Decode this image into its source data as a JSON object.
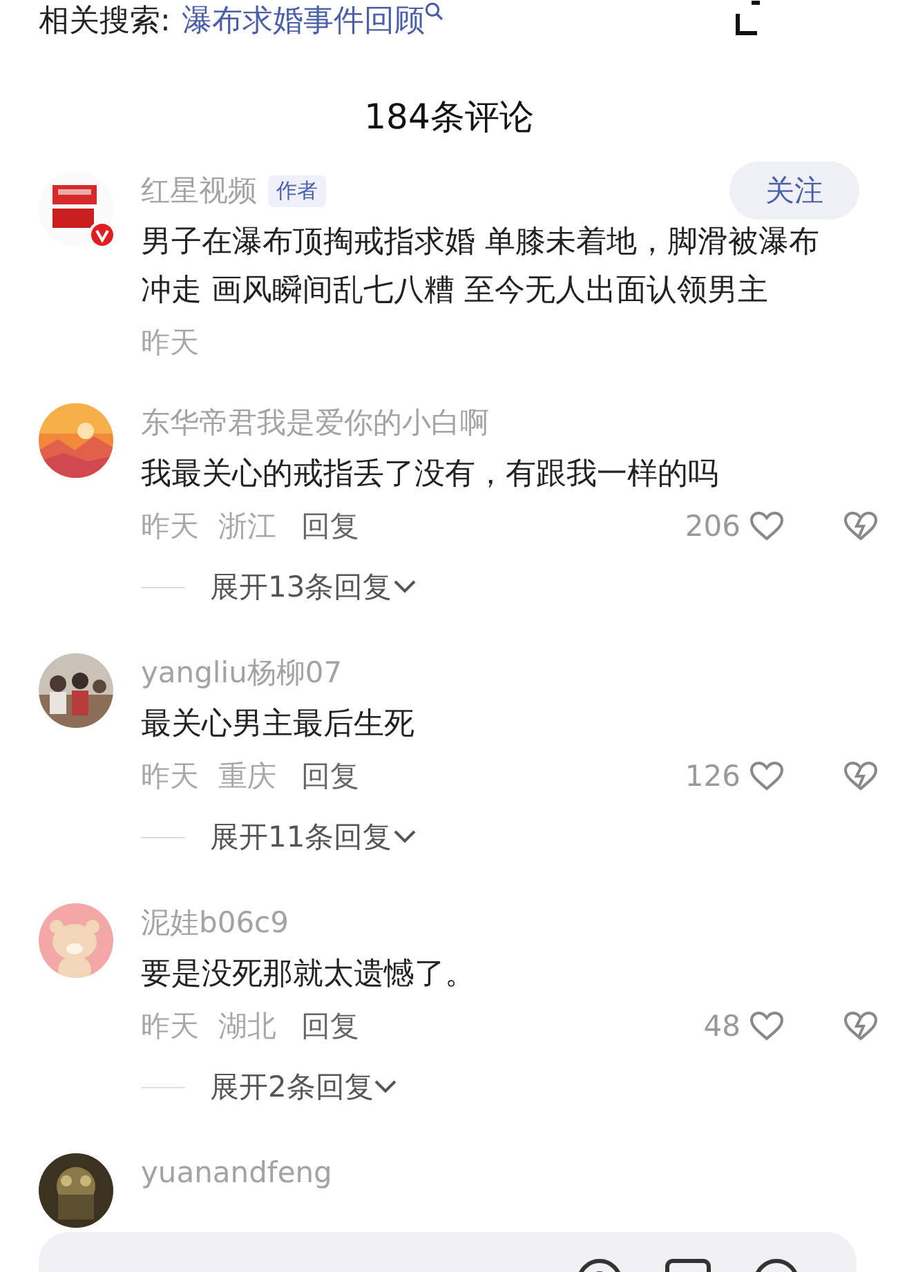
{
  "related_search": {
    "label": "相关搜索:",
    "query": "瀑布求婚事件回顾"
  },
  "comments_title": "184条评论",
  "comments": [
    {
      "kind": "author",
      "user": "红星视频",
      "badge": "作者",
      "follow": "关注",
      "text": "男子在瀑布顶掏戒指求婚 单膝未着地，脚滑被瀑布冲走 画风瞬间乱七八糟 至今无人出面认领男主",
      "time": "昨天"
    },
    {
      "kind": "reply",
      "user": "东华帝君我是爱你的小白啊",
      "text": "我最关心的戒指丢了没有，有跟我一样的吗",
      "time": "昨天",
      "region": "浙江",
      "reply": "回复",
      "likes": "206",
      "expand": "展开13条回复"
    },
    {
      "kind": "reply",
      "user": "yangliu杨柳07",
      "text": "最关心男主最后生死",
      "time": "昨天",
      "region": "重庆",
      "reply": "回复",
      "likes": "126",
      "expand": "展开11条回复"
    },
    {
      "kind": "reply",
      "user": "泥娃b06c9",
      "text": "要是没死那就太遗憾了。",
      "time": "昨天",
      "region": "湖北",
      "reply": "回复",
      "likes": "48",
      "expand": "展开2条回复"
    },
    {
      "kind": "cut",
      "user": "yuanandfeng"
    }
  ]
}
